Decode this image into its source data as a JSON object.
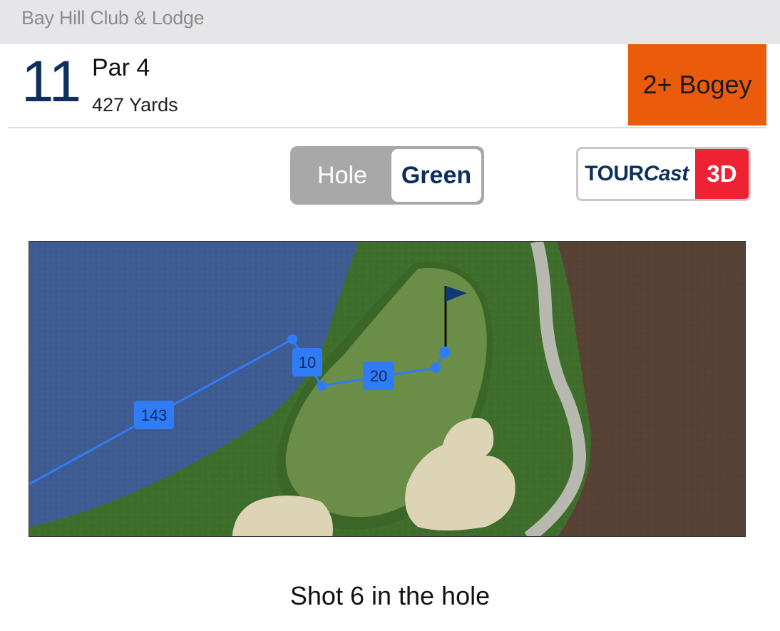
{
  "course": {
    "name": "Bay Hill Club & Lodge"
  },
  "hole": {
    "number": "11",
    "par": "Par 4",
    "yards": "427 Yards",
    "score": "2+ Bogey",
    "score_color": "#ea5b0c"
  },
  "toggle": {
    "options": [
      "Hole",
      "Green"
    ],
    "selected": "Green"
  },
  "tourcast": {
    "brand_prefix": "TOUR",
    "brand_suffix": "Cast",
    "badge": "3D",
    "badge_color": "#ee2233"
  },
  "map": {
    "icons": [
      "pin-flag-icon"
    ],
    "shots": [
      {
        "distance": "143"
      },
      {
        "distance": "10"
      },
      {
        "distance": "20"
      }
    ],
    "colors": {
      "water": "#3f5c92",
      "rough": "#3f6d2c",
      "green": "#6a8d48",
      "bunker": "#ddd4b5",
      "cart_path": "#b7b9b0",
      "dirt": "#584135",
      "shot_line": "#2f7cf6"
    }
  },
  "shot_description": "Shot 6 in the hole"
}
